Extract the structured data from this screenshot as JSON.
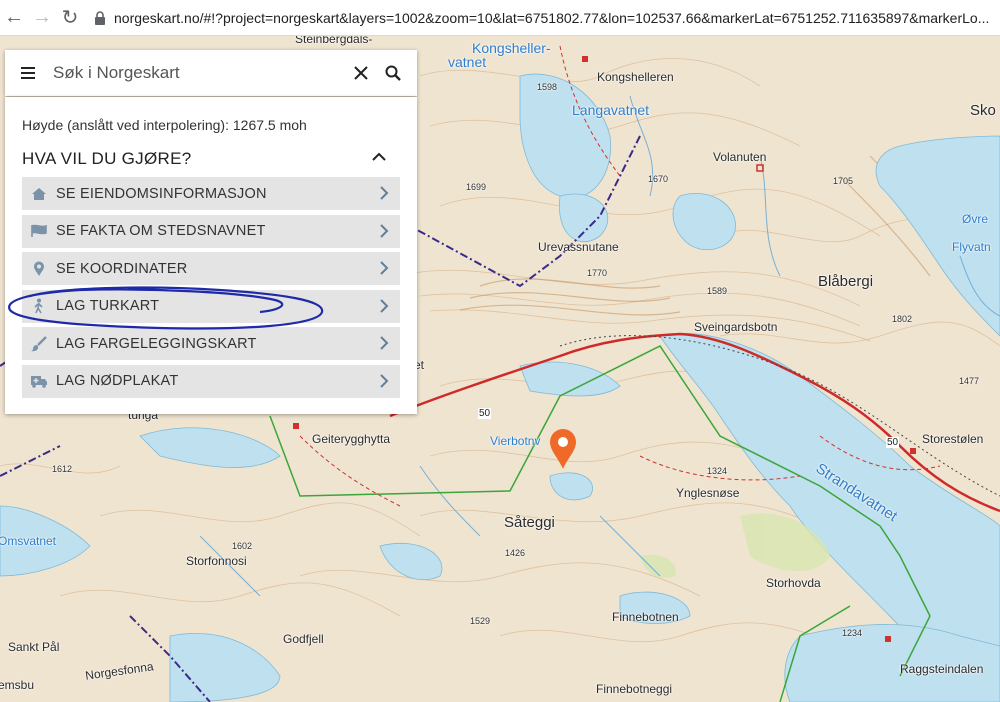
{
  "browser": {
    "url": "norgeskart.no/#!?project=norgeskart&layers=1002&zoom=10&lat=6751802.77&lon=102537.66&markerLat=6751252.711635897&markerLo..."
  },
  "search": {
    "placeholder": "Søk i Norgeskart"
  },
  "panel": {
    "height_info": "Høyde (anslått ved interpolering): 1267.5 moh",
    "section_title": "HVA VIL DU GJØRE?",
    "items": [
      {
        "label": "SE EIENDOMSINFORMASJON",
        "icon": "house-icon"
      },
      {
        "label": "SE FAKTA OM STEDSNAVNET",
        "icon": "flag-icon"
      },
      {
        "label": "SE KOORDINATER",
        "icon": "map-pin-icon"
      },
      {
        "label": "LAG TURKART",
        "icon": "hiker-icon"
      },
      {
        "label": "LAG FARGELEGGINGSKART",
        "icon": "paint-brush-icon"
      },
      {
        "label": "LAG NØDPLAKAT",
        "icon": "ambulance-icon"
      }
    ]
  },
  "map": {
    "labels": {
      "steinbergdals": "Steinbergdals-",
      "kongsheller_vatnet_1": "Kongsheller-",
      "kongsheller_vatnet_2": "vatnet",
      "kongshelleren": "Kongshelleren",
      "langavatnet": "Langavatnet",
      "volanuten": "Volanuten",
      "urevassnutane": "Urevassnutane",
      "blabergi": "Blåbergi",
      "sveingardsbotn": "Sveingardsbotn",
      "storestolen": "Storestølen",
      "strandavatnet": "Strandavatnet",
      "geiterygghytta": "Geiterygghytta",
      "vierbotnv": "Vierbotnv",
      "ynglesnose": "Ynglesnøse",
      "sateggi": "Såteggi",
      "storfonnosi": "Storfonnosi",
      "godfjell": "Godfjell",
      "storhovda": "Storhovda",
      "finnebotnen": "Finnebotnen",
      "finnebotneggi": "Finnebotneggi",
      "raggsteindalen": "Raggsteindalen",
      "sankt_pal": "Sankt Pål",
      "norgesfonna": "Norgesfonna",
      "omsvatnet": "Omsvatnet",
      "emsbu": "emsbu",
      "tunga": "tunga",
      "ovre": "Øvre",
      "flyvatn": "Flyvatn",
      "sko": "Sko",
      "et": "et"
    },
    "elevations": {
      "e1598": "1598",
      "e1699": "1699",
      "e1670": "1670",
      "e1705": "1705",
      "e1770": "1770",
      "e1589": "1589",
      "e1802": "1802",
      "e1477": "1477",
      "e1612": "1612",
      "e1324": "1324",
      "e1426": "1426",
      "e1602": "1602",
      "e1529": "1529",
      "e1234": "1234"
    },
    "roads": {
      "r50a": "50",
      "r50b": "50"
    }
  },
  "colors": {
    "accent_marker": "#ef6a29",
    "annotation_circle": "#1f2aa8",
    "water": "#bfe0ee",
    "road": "#cf2a2a",
    "boundary_green": "#3aa63a",
    "border_purple": "#3a2a8a"
  }
}
